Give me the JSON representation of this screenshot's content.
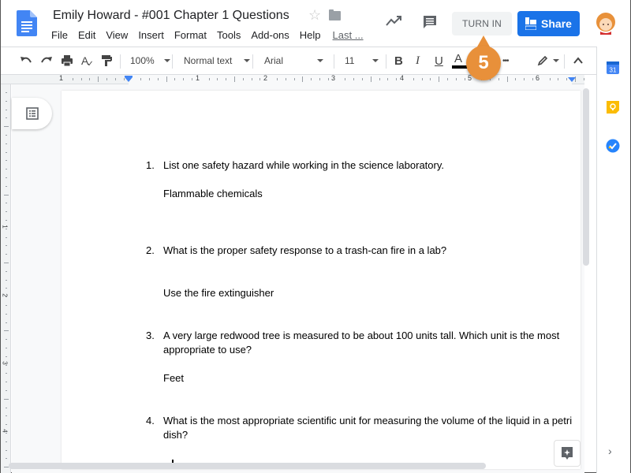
{
  "header": {
    "doc_title": "Emily Howard - #001 Chapter 1  Questions",
    "menu": [
      "File",
      "Edit",
      "View",
      "Insert",
      "Format",
      "Tools",
      "Add-ons",
      "Help"
    ],
    "last_edit": "Last ...",
    "turn_in_label": "TURN IN",
    "share_label": "Share"
  },
  "toolbar": {
    "zoom": "100%",
    "style": "Normal text",
    "font": "Arial",
    "font_size": "11",
    "bold": "B",
    "italic": "I",
    "underline": "U",
    "text_color": "A",
    "more": "•••"
  },
  "ruler": {
    "h_labels": [
      "1",
      "1",
      "2",
      "3",
      "4",
      "5",
      "6"
    ],
    "v_labels": [
      "1",
      "2",
      "3",
      "4"
    ]
  },
  "callout": {
    "step": "5",
    "color": "#e8903a"
  },
  "document": {
    "questions": [
      {
        "num": "1.",
        "text": "List one safety hazard while working in the science laboratory.",
        "answer": "Flammable chemicals"
      },
      {
        "num": "2.",
        "text": "What is the proper safety response to a trash-can fire in a lab?",
        "answer": "Use the fire extinguisher"
      },
      {
        "num": "3.",
        "text": "A very large redwood tree is measured to be about 100 units tall. Which unit is the most appropriate to use?",
        "answer": "Feet"
      },
      {
        "num": "4.",
        "text": "What is the most appropriate scientific unit for measuring the volume of the liquid in a petri dish?",
        "answer": ""
      }
    ]
  },
  "colors": {
    "share_blue": "#1a73e8",
    "docs_blue": "#4285f4"
  }
}
